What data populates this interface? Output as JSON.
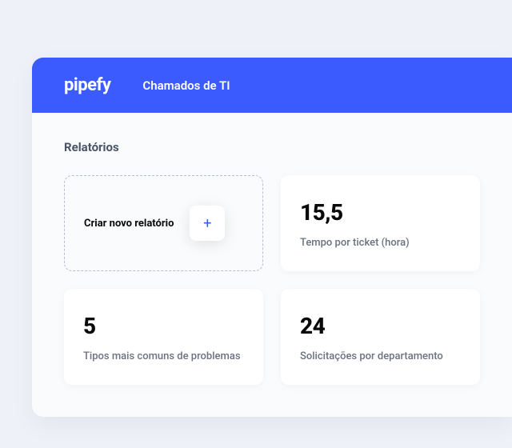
{
  "brand": "pipefy",
  "header": {
    "title": "Chamados de TI"
  },
  "section": {
    "title": "Relatórios"
  },
  "create": {
    "label": "Criar novo relatório",
    "icon": "+"
  },
  "cards": [
    {
      "value": "15,5",
      "label": "Tempo por ticket (hora)"
    },
    {
      "value": "5",
      "label": "Tipos mais comuns de problemas"
    },
    {
      "value": "24",
      "label": "Solicitações por departamento"
    }
  ]
}
